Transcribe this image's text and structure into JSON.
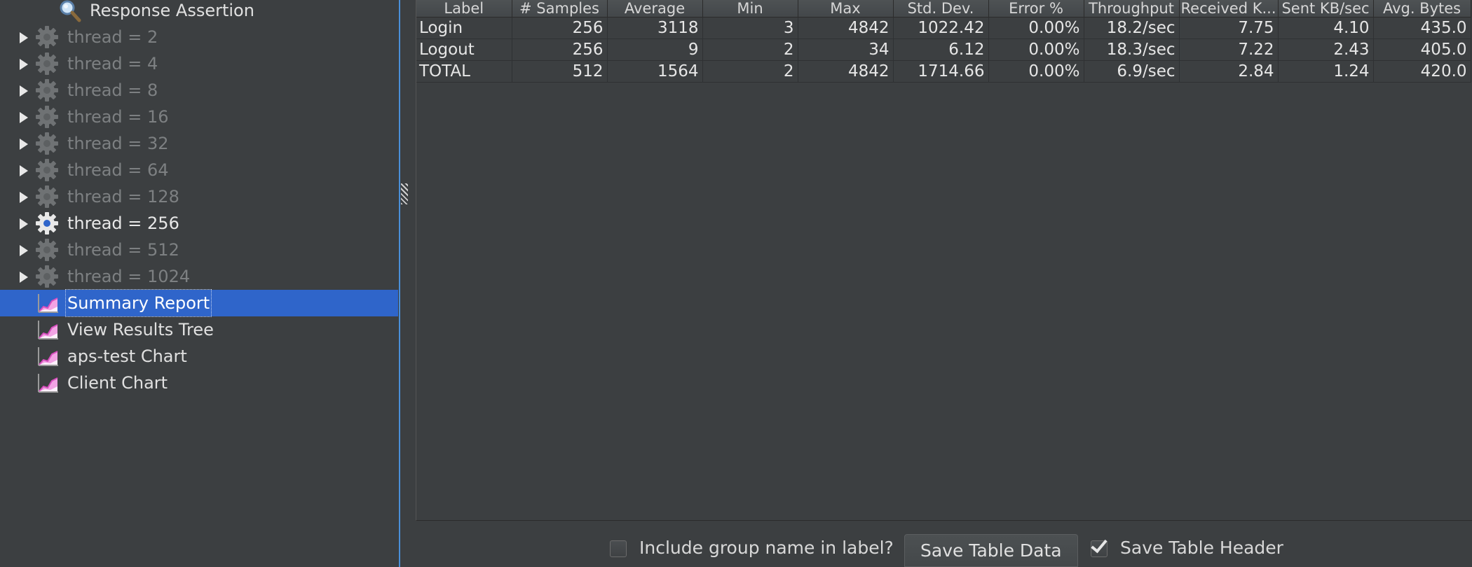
{
  "tree": {
    "assertion": {
      "label": "Response Assertion",
      "icon": "magnifier-icon"
    },
    "thread_groups": [
      {
        "label": "thread = 2",
        "enabled": false
      },
      {
        "label": "thread = 4",
        "enabled": false
      },
      {
        "label": "thread = 8",
        "enabled": false
      },
      {
        "label": "thread = 16",
        "enabled": false
      },
      {
        "label": "thread = 32",
        "enabled": false
      },
      {
        "label": "thread = 64",
        "enabled": false
      },
      {
        "label": "thread = 128",
        "enabled": false
      },
      {
        "label": "thread = 256",
        "enabled": true
      },
      {
        "label": "thread = 512",
        "enabled": false
      },
      {
        "label": "thread = 1024",
        "enabled": false
      }
    ],
    "listeners": [
      {
        "label": "Summary Report",
        "selected": true
      },
      {
        "label": "View Results Tree",
        "selected": false
      },
      {
        "label": "aps-test Chart",
        "selected": false
      },
      {
        "label": "Client Chart",
        "selected": false
      }
    ]
  },
  "summary_table": {
    "columns": [
      "Label",
      "# Samples",
      "Average",
      "Min",
      "Max",
      "Std. Dev.",
      "Error %",
      "Throughput",
      "Received K...",
      "Sent KB/sec",
      "Avg. Bytes"
    ],
    "rows": [
      [
        "Login",
        "256",
        "3118",
        "3",
        "4842",
        "1022.42",
        "0.00%",
        "18.2/sec",
        "7.75",
        "4.10",
        "435.0"
      ],
      [
        "Logout",
        "256",
        "9",
        "2",
        "34",
        "6.12",
        "0.00%",
        "18.3/sec",
        "7.22",
        "2.43",
        "405.0"
      ],
      [
        "TOTAL",
        "512",
        "1564",
        "2",
        "4842",
        "1714.66",
        "0.00%",
        "6.9/sec",
        "2.84",
        "1.24",
        "420.0"
      ]
    ]
  },
  "bottom_bar": {
    "include_group_name": {
      "label": "Include group name in label?",
      "checked": false
    },
    "save_table_data": "Save Table Data",
    "save_table_header": {
      "label": "Save Table Header",
      "checked": true
    }
  },
  "colors": {
    "background": "#3c3f41",
    "selection": "#2f65ca",
    "disabled_text": "#7d8082",
    "listener_icon": "#e86fd0"
  }
}
